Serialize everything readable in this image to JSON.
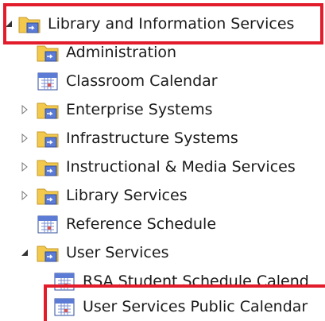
{
  "tree": {
    "root": {
      "label": "Library and Information Services",
      "expanded": true,
      "icon": "folder-calendar-icon"
    },
    "items": [
      {
        "label": "Administration",
        "icon": "folder-calendar-icon",
        "has_children": false
      },
      {
        "label": "Classroom Calendar",
        "icon": "calendar-icon",
        "has_children": false
      },
      {
        "label": "Enterprise Systems",
        "icon": "folder-calendar-icon",
        "has_children": true,
        "expanded": false
      },
      {
        "label": "Infrastructure Systems",
        "icon": "folder-calendar-icon",
        "has_children": true,
        "expanded": false
      },
      {
        "label": "Instructional & Media Services",
        "icon": "folder-calendar-icon",
        "has_children": true,
        "expanded": false
      },
      {
        "label": "Library Services",
        "icon": "folder-calendar-icon",
        "has_children": true,
        "expanded": false
      },
      {
        "label": "Reference Schedule",
        "icon": "calendar-icon",
        "has_children": false
      },
      {
        "label": "User Services",
        "icon": "folder-calendar-icon",
        "has_children": true,
        "expanded": true
      }
    ],
    "user_services_children": [
      {
        "label": "RSA Student Schedule Calend",
        "icon": "calendar-icon"
      },
      {
        "label": "User Services Public Calendar",
        "icon": "calendar-icon"
      }
    ]
  },
  "colors": {
    "highlight": "#e21c2a",
    "folder": "#f2c94c",
    "calendar": "#5b7bd5"
  }
}
